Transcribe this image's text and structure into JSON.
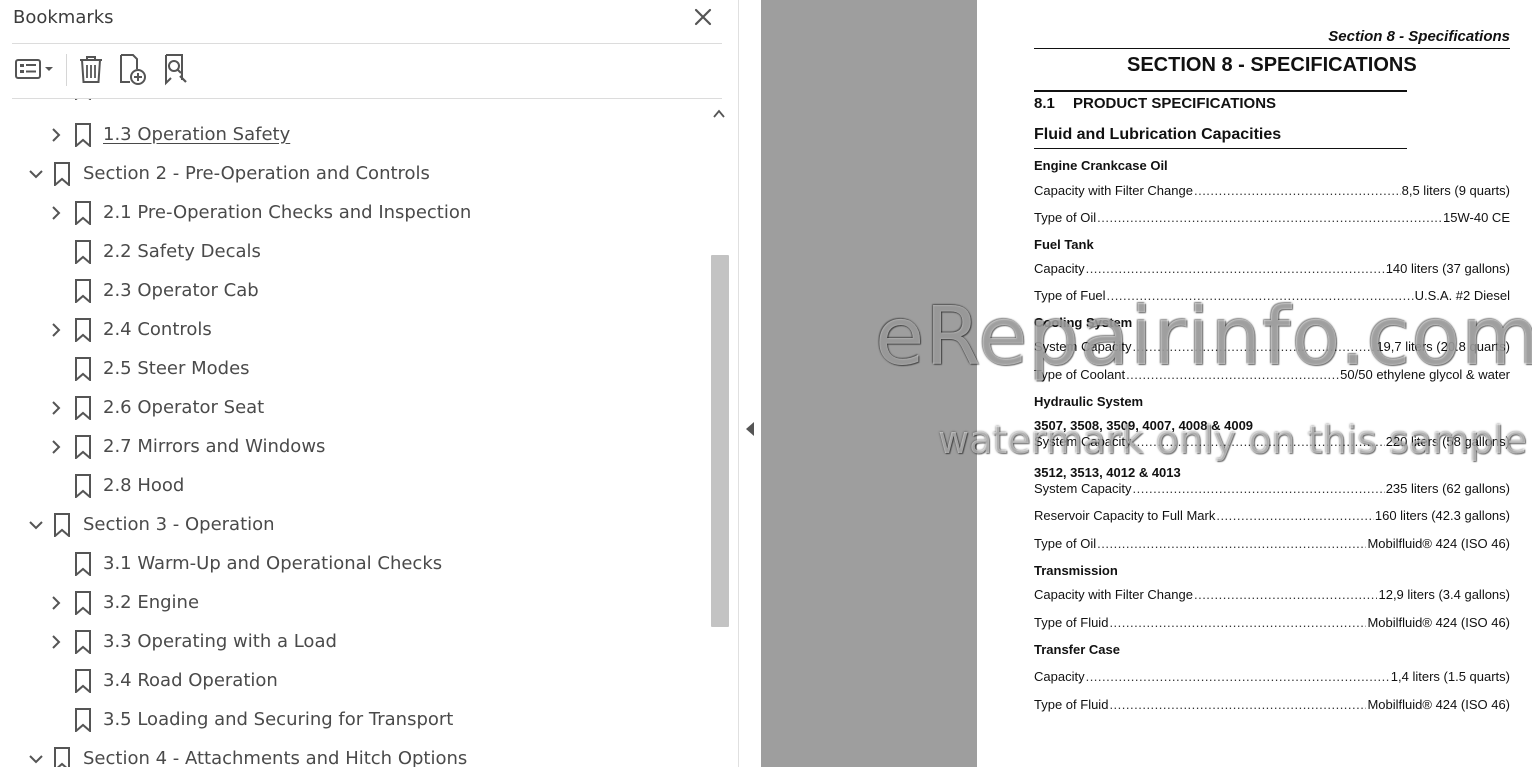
{
  "bookmarks_panel": {
    "title": "Bookmarks",
    "close_icon": "close-icon",
    "toolbar": {
      "options_icon": "list-options-icon",
      "delete_icon": "trash-icon",
      "add_icon": "add-bookmark-icon",
      "find_icon": "find-bookmark-icon"
    },
    "items": [
      {
        "label": "1.3 Operation Safety",
        "level": 1,
        "expandable": true,
        "expanded": false,
        "underlined": true
      },
      {
        "label": "Section 2 - Pre-Operation and Controls",
        "level": 0,
        "expandable": true,
        "expanded": true
      },
      {
        "label": "2.1 Pre-Operation Checks and Inspection",
        "level": 1,
        "expandable": true,
        "expanded": false
      },
      {
        "label": "2.2 Safety Decals",
        "level": 1,
        "expandable": false
      },
      {
        "label": "2.3 Operator Cab",
        "level": 1,
        "expandable": false
      },
      {
        "label": "2.4 Controls",
        "level": 1,
        "expandable": true,
        "expanded": false
      },
      {
        "label": "2.5 Steer Modes",
        "level": 1,
        "expandable": false
      },
      {
        "label": "2.6 Operator Seat",
        "level": 1,
        "expandable": true,
        "expanded": false
      },
      {
        "label": "2.7 Mirrors and Windows",
        "level": 1,
        "expandable": true,
        "expanded": false
      },
      {
        "label": "2.8 Hood",
        "level": 1,
        "expandable": false
      },
      {
        "label": "Section 3 - Operation",
        "level": 0,
        "expandable": true,
        "expanded": true
      },
      {
        "label": "3.1 Warm-Up and Operational Checks",
        "level": 1,
        "expandable": false
      },
      {
        "label": "3.2 Engine",
        "level": 1,
        "expandable": true,
        "expanded": false
      },
      {
        "label": "3.3 Operating with a Load",
        "level": 1,
        "expandable": true,
        "expanded": false
      },
      {
        "label": "3.4 Road Operation",
        "level": 1,
        "expandable": false
      },
      {
        "label": "3.5 Loading and Securing for Transport",
        "level": 1,
        "expandable": false
      },
      {
        "label": "Section 4 - Attachments and Hitch Options",
        "level": 0,
        "expandable": true,
        "expanded": true
      }
    ]
  },
  "document": {
    "running_header": "Section 8 - Specifications",
    "section_title": "SECTION 8 - SPECIFICATIONS",
    "subsection_number": "8.1",
    "subsection_title": "PRODUCT SPECIFICATIONS",
    "fluid_title": "Fluid and Lubrication Capacities",
    "groups": [
      {
        "heading": "Engine Crankcase Oil",
        "lines": [
          {
            "label": "Capacity with Filter Change",
            "value": "8,5 liters (9 quarts)"
          },
          {
            "label": "Type of Oil",
            "value": "15W-40 CE"
          }
        ]
      },
      {
        "heading": "Fuel Tank",
        "lines": [
          {
            "label": "Capacity",
            "value": "140 liters (37 gallons)"
          },
          {
            "label": "Type of Fuel",
            "value": "U.S.A. #2 Diesel"
          }
        ]
      },
      {
        "heading": "Cooling System",
        "lines": [
          {
            "label": "System Capacity",
            "value": "19,7 liters (20.8 quarts)"
          },
          {
            "label": "Type of Coolant",
            "value": "50/50 ethylene glycol & water"
          }
        ]
      },
      {
        "heading": "Hydraulic System",
        "lines": []
      },
      {
        "heading": "3507, 3508, 3509, 4007, 4008 & 4009",
        "lines": [
          {
            "label": "System Capacity",
            "value": "220 liters (58 gallons)"
          }
        ]
      },
      {
        "heading": "3512, 3513, 4012 & 4013",
        "lines": [
          {
            "label": "System Capacity",
            "value": "235 liters (62 gallons)"
          },
          {
            "label": "Reservoir Capacity to Full Mark",
            "value": "160 liters (42.3 gallons)"
          },
          {
            "label": "Type of Oil",
            "value": "Mobilfluid® 424 (ISO 46)"
          }
        ]
      },
      {
        "heading": "Transmission",
        "lines": [
          {
            "label": "Capacity with Filter Change",
            "value": "12,9 liters (3.4 gallons)"
          },
          {
            "label": "Type of Fluid",
            "value": "Mobilfluid® 424 (ISO 46)"
          }
        ]
      },
      {
        "heading": "Transfer Case",
        "lines": [
          {
            "label": "Capacity",
            "value": "1,4 liters (1.5 quarts)"
          },
          {
            "label": "Type of Fluid",
            "value": "Mobilfluid® 424 (ISO 46)"
          }
        ]
      }
    ]
  },
  "watermark": {
    "main": "eRepairinfo.com",
    "sub": "watermark only on this sample"
  },
  "colors": {
    "page_gray": "#9e9e9e",
    "text_gray": "#4a4a4a",
    "scroll_thumb": "#c3c3c3"
  }
}
